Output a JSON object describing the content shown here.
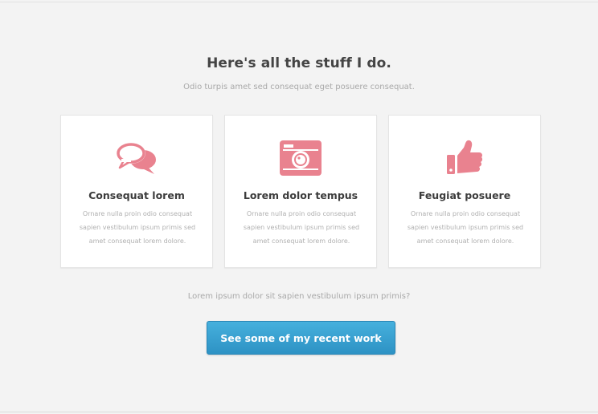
{
  "header": {
    "title": "Here's all the stuff I do.",
    "subtitle": "Odio turpis amet sed consequat eget posuere consequat."
  },
  "features": [
    {
      "icon": "chat-bubbles-icon",
      "title": "Consequat lorem",
      "text": "Ornare nulla proin odio consequat sapien vestibulum ipsum primis sed amet consequat lorem dolore."
    },
    {
      "icon": "camera-icon",
      "title": "Lorem dolor tempus",
      "text": "Ornare nulla proin odio consequat sapien vestibulum ipsum primis sed amet consequat lorem dolore."
    },
    {
      "icon": "thumbs-up-icon",
      "title": "Feugiat posuere",
      "text": "Ornare nulla proin odio consequat sapien vestibulum ipsum primis sed amet consequat lorem dolore."
    }
  ],
  "footer": {
    "question": "Lorem ipsum dolor sit sapien vestibulum ipsum primis?",
    "button_label": "See some of my recent work"
  },
  "colors": {
    "icon_accent": "#e9828f",
    "button": "#3aa3d3"
  }
}
